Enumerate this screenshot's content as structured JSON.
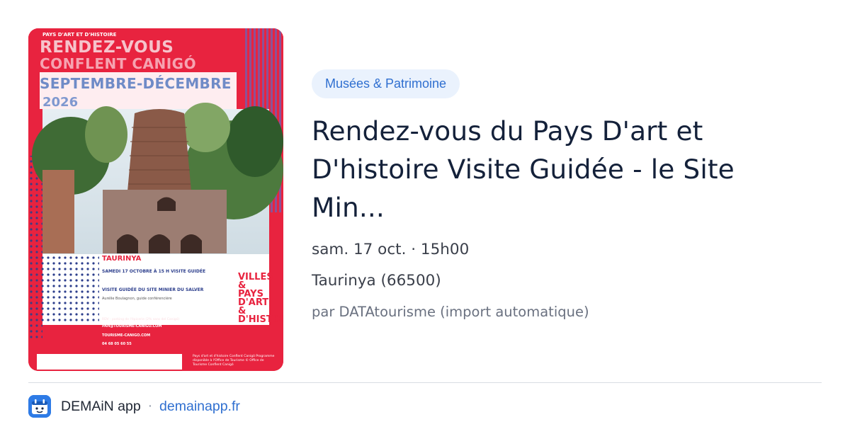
{
  "poster": {
    "header": "PAYS D'ART ET D'HISTOIRE",
    "title_line1": "RENDEZ-VOUS",
    "title_line2": "CONFLENT CANIGÓ",
    "title_line3": "SEPTEMBRE-DÉCEMBRE",
    "title_line4": "2026",
    "place": "TAURINYA",
    "detail1": "SAMEDI 17 OCTOBRE À 15 H VISITE GUIDÉE",
    "detail2": "VISITE GUIDÉE DU SITE MINIER DU SALVER",
    "detail3": "Aurélie Boulagnon, guide conférencière",
    "detail4": "RDV : parking de l'épicerie (2% sans del Canigó)",
    "detail5": "PAH@TOURISME-CANIGO.COM",
    "detail6": "TOURISME-CANIGO.COM",
    "detail7": "04 68 05 60 55",
    "side_label": "VILLES & PAYS D'ART & D'HISTOIRE",
    "footer": "Pays d'art et d'histoire Conflent Canigó Programme disponible à l'Office de Tourisme © Office de Tourisme Conflent Canigó",
    "colors": {
      "red": "#e8233f",
      "navy": "#2c3e8c",
      "pink": "#f6c3cb",
      "blue": "#6f8bc7"
    }
  },
  "event": {
    "category": "Musées & Patrimoine",
    "title": "Rendez-vous du Pays D'art et D'histoire Visite Guidée - le Site Min...",
    "datetime": "sam. 17 oct. · 15h00",
    "location": "Taurinya (66500)",
    "source": "par DATAtourisme (import automatique)"
  },
  "footer": {
    "app_name": "DEMAiN app",
    "separator": "·",
    "domain": "demainapp.fr",
    "app_icon": "demain-app-icon"
  },
  "colors": {
    "accent": "#2f6fd0",
    "tag_bg": "#eaf2fd",
    "title": "#14213a",
    "meta": "#3a3f4a"
  }
}
